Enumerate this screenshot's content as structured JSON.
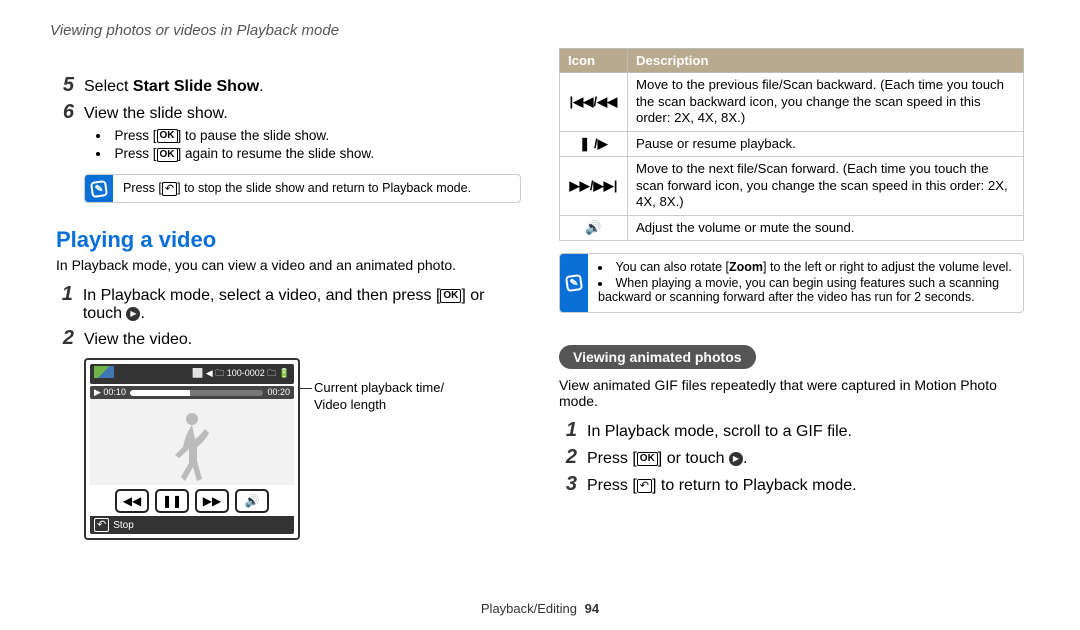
{
  "header": "Viewing photos or videos in Playback mode",
  "left": {
    "steps_top": [
      {
        "num": "5",
        "html": "Select <b>Start Slide Show</b>."
      },
      {
        "num": "6",
        "html": "View the slide show."
      }
    ],
    "subbullets": [
      "Press [OK] to pause the slide show.",
      "Press [OK] again to resume the slide show."
    ],
    "note1": "Press [↶] to stop the slide show and return to Playback mode.",
    "section_title": "Playing a video",
    "section_intro": "In Playback mode, you can view a video and an animated photo.",
    "steps_play": [
      {
        "num": "1",
        "html": "In Playback mode, select a video, and then press [OK] or touch ▶."
      },
      {
        "num": "2",
        "html": "View the video."
      }
    ],
    "screen": {
      "top_right": "100-0002",
      "time_left": "00:10",
      "time_right": "00:20",
      "stop": "Stop"
    },
    "caption": "Current playback time/\nVideo length"
  },
  "right": {
    "table_headers": {
      "icon": "Icon",
      "desc": "Description"
    },
    "rows": [
      {
        "icon": "|◀◀/◀◀",
        "desc": "Move to the previous file/Scan backward. (Each time you touch the scan backward icon, you change the scan speed in this order: 2X, 4X, 8X.)"
      },
      {
        "icon": "❚ /▶",
        "desc": "Pause or resume playback."
      },
      {
        "icon": "▶▶/▶▶|",
        "desc": "Move to the next file/Scan forward. (Each time you touch the scan forward icon, you change the scan speed in this order: 2X, 4X, 8X.)"
      },
      {
        "icon": "🔊",
        "desc": "Adjust the volume or mute the sound."
      }
    ],
    "note2": [
      "You can also rotate [Zoom] to the left or right to adjust the volume level.",
      "When playing a movie, you can begin using features such a scanning backward or scanning forward after the video has run for 2 seconds."
    ],
    "pill": "Viewing animated photos",
    "pill_intro": "View animated GIF files repeatedly that were captured in Motion Photo mode.",
    "steps_gif": [
      {
        "num": "1",
        "html": "In Playback mode, scroll to a GIF file."
      },
      {
        "num": "2",
        "html": "Press [OK] or touch ▶."
      },
      {
        "num": "3",
        "html": "Press [↶] to return to Playback mode."
      }
    ]
  },
  "footer": {
    "section": "Playback/Editing",
    "page": "94"
  }
}
